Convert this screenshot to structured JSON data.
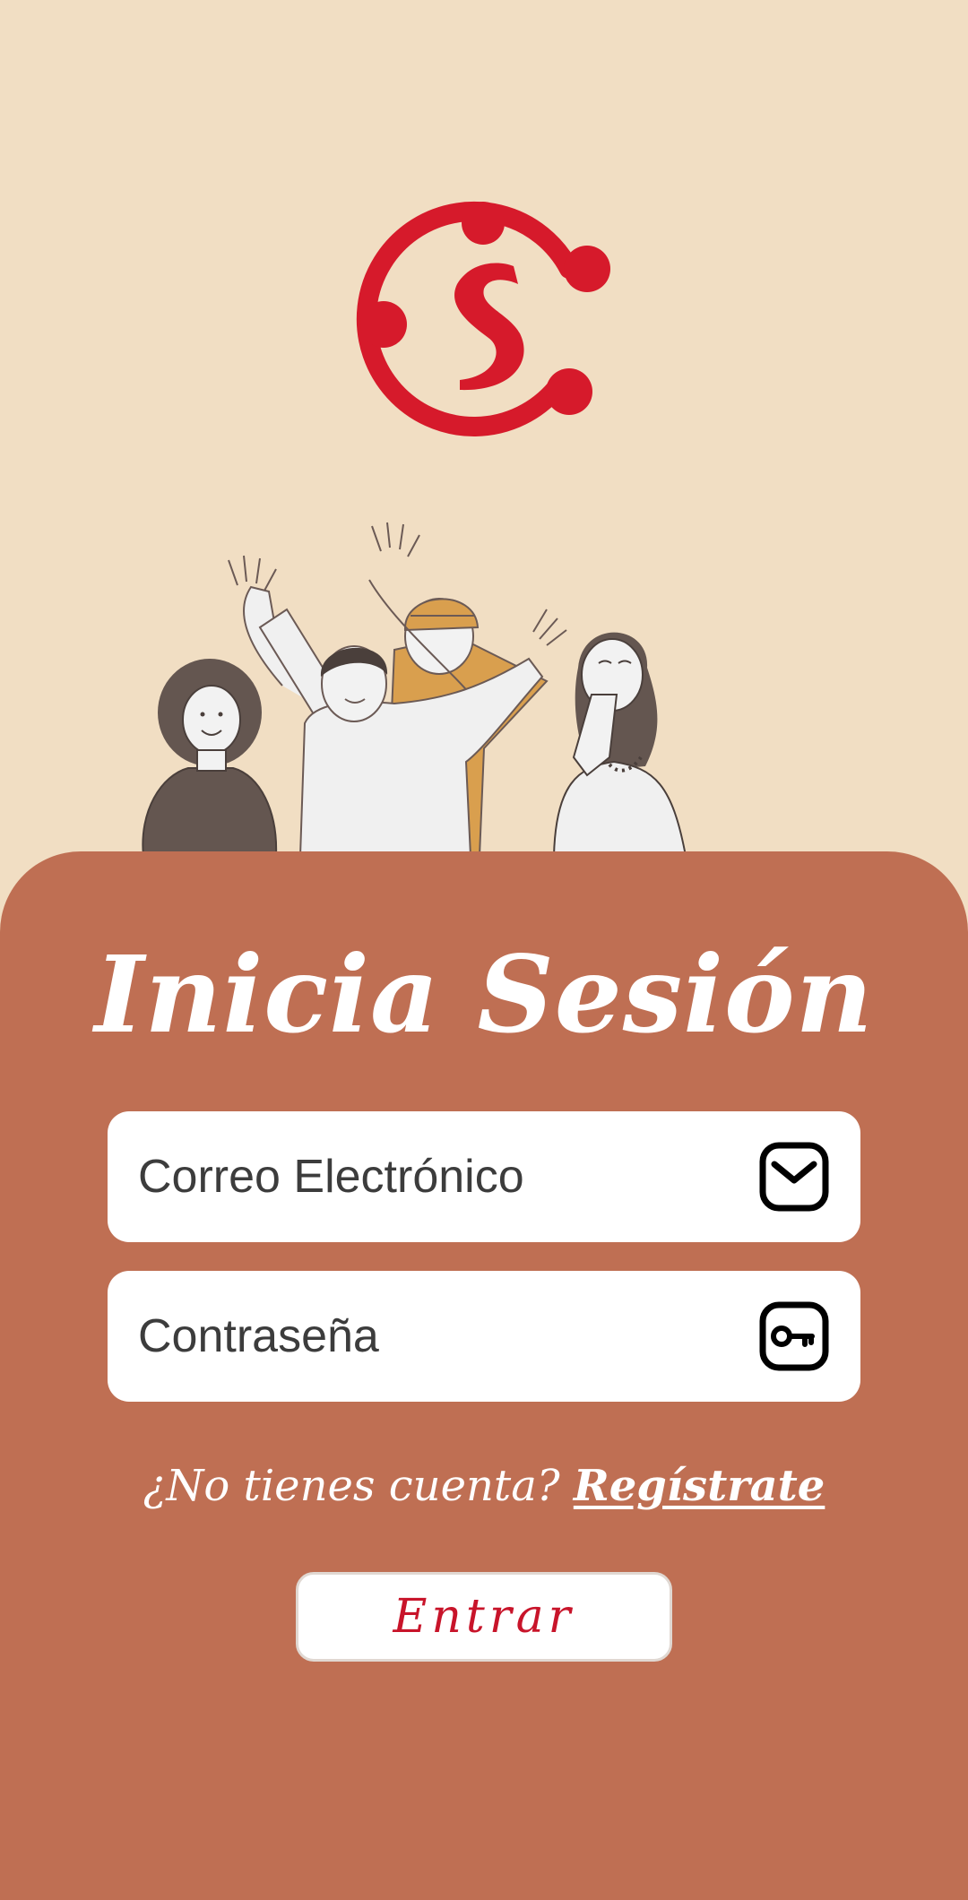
{
  "login": {
    "title": "Inicia Sesión",
    "email_placeholder": "Correo Electrónico",
    "password_placeholder": "Contraseña",
    "no_account_text": "¿No tienes cuenta?",
    "register_link": "Regístrate",
    "enter_button": "Entrar"
  },
  "icons": {
    "logo": "app-logo",
    "email": "mail-icon",
    "password": "key-icon"
  },
  "colors": {
    "background": "#F1DEC3",
    "panel": "#BF6F53",
    "brand_red": "#D61A2B",
    "button_text": "#C8142A"
  }
}
